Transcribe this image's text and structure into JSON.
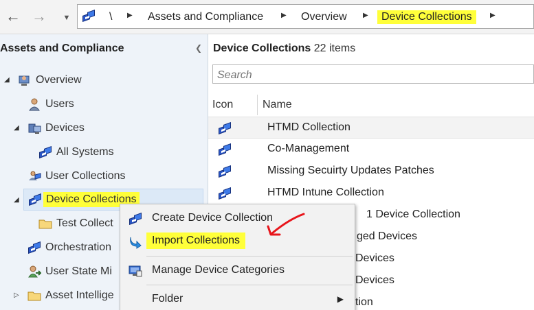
{
  "address_bar": {
    "root_symbol": "\\",
    "crumbs": [
      "Assets and Compliance",
      "Overview",
      "Device Collections"
    ]
  },
  "left_pane": {
    "title": "Assets and Compliance",
    "tree": {
      "overview": "Overview",
      "users": "Users",
      "devices": "Devices",
      "all_systems": "All Systems",
      "user_collections": "User Collections",
      "device_collections": "Device Collections",
      "test_collections": "Test Collect",
      "orchestration": "Orchestration",
      "user_state_migration": "User State Mi",
      "asset_intelligence": "Asset Intellige"
    }
  },
  "right_pane": {
    "title": "Device Collections",
    "count": "22 items",
    "search_placeholder": "Search",
    "columns": [
      "Icon",
      "Name"
    ],
    "rows": [
      "HTMD Collection",
      "Co-Management",
      "Missing Secuirty Updates Patches",
      "HTMD Intune Collection",
      "1 Device Collection",
      "ged Devices",
      "Devices",
      "Devices",
      "tion"
    ]
  },
  "context_menu": {
    "items": [
      "Create Device Collection",
      "Import Collections",
      "Manage Device Categories",
      "Folder"
    ]
  },
  "colors": {
    "highlight": "#ffff3a",
    "annotation": "#e8151b",
    "collection_icon": "#2a56c6"
  }
}
